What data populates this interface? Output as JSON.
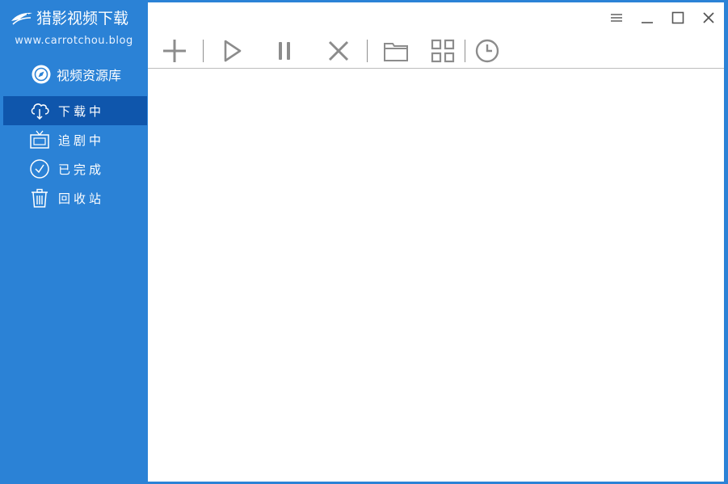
{
  "app": {
    "title": "猎影视频下载",
    "website": "www.carrotchou.blog"
  },
  "sidebar": {
    "library": {
      "label": "视频资源库",
      "icon": "compass-icon"
    },
    "items": [
      {
        "label": "下载中",
        "icon": "cloud-download-icon",
        "active": true
      },
      {
        "label": "追剧中",
        "icon": "tv-icon",
        "active": false
      },
      {
        "label": "已完成",
        "icon": "check-circle-icon",
        "active": false
      },
      {
        "label": "回收站",
        "icon": "trash-icon",
        "active": false
      }
    ]
  },
  "window_controls": [
    "menu-icon",
    "minimize-icon",
    "maximize-icon",
    "close-icon"
  ],
  "toolbar": [
    "add-icon",
    "play-icon",
    "pause-icon",
    "delete-icon",
    "folder-icon",
    "grid-icon",
    "clock-icon"
  ],
  "colors": {
    "sidebar_bg": "#2b82d6",
    "active_item_bg": "#0f56ac",
    "content_bg": "#ffffff",
    "toolbar_icon": "#8c8c8c",
    "window_control": "#555555"
  }
}
